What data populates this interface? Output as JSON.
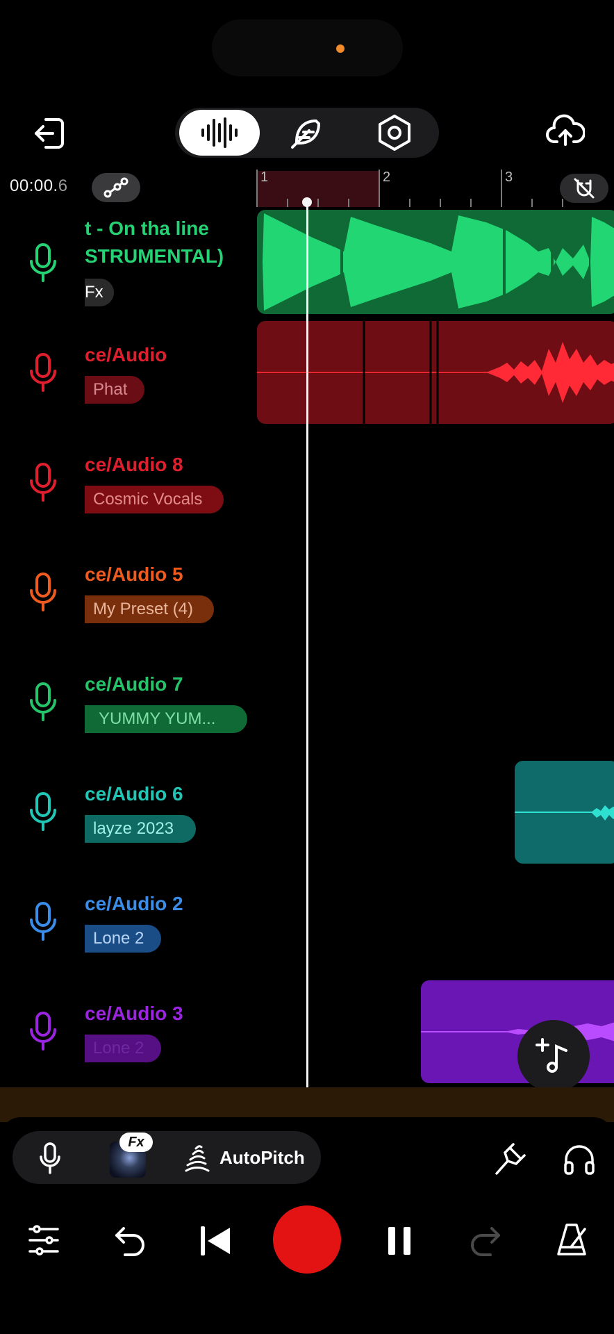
{
  "header": {
    "back_icon": "exit-arrow-icon",
    "modes": [
      {
        "name": "waveform-mode",
        "icon": "waveform-icon",
        "active": true
      },
      {
        "name": "effects-mode",
        "icon": "feather-icon",
        "active": false
      },
      {
        "name": "settings-mode",
        "icon": "hex-nut-icon",
        "active": false
      }
    ],
    "upload_icon": "cloud-upload-icon"
  },
  "timeline": {
    "time_main": "00:00.",
    "time_frac": "6",
    "automation_icon": "automation-nodes-icon",
    "ruler_numbers": [
      "1",
      "2",
      "3"
    ],
    "snap_icon": "magnet-off-icon"
  },
  "tracks": [
    {
      "name_line1": "t - On tha line",
      "name_line2": "STRUMENTAL)",
      "badge": "Fx",
      "color": "#25d274",
      "badge_bg": "#2a2a2a"
    },
    {
      "name_line1": "ce/Audio",
      "badge": "Phat",
      "color": "#e01f2e",
      "badge_bg": "#6a0d14",
      "badge_color": "#d8898f"
    },
    {
      "name_line1": "ce/Audio 8",
      "badge": "Cosmic Vocals",
      "color": "#e01f2e",
      "badge_bg": "#7d0d12",
      "badge_color": "#e38a8a"
    },
    {
      "name_line1": "ce/Audio 5",
      "badge": "My Preset (4)",
      "color": "#ef5a1e",
      "badge_bg": "#7a2f0c",
      "badge_color": "#e9b59a"
    },
    {
      "name_line1": "ce/Audio 7",
      "badge": "YUMMY YUM...",
      "color": "#25c46a",
      "badge_bg": "#0f6a35",
      "badge_color": "#7fe0a5"
    },
    {
      "name_line1": "ce/Audio 6",
      "badge": "layze 2023",
      "color": "#21c6b6",
      "badge_bg": "#0e6a63",
      "badge_color": "#9ff0e6"
    },
    {
      "name_line1": "ce/Audio 2",
      "badge": "Lone 2",
      "color": "#3a8de8",
      "badge_bg": "#1a4c86",
      "badge_color": "#b8d6f6"
    },
    {
      "name_line1": "ce/Audio 3",
      "badge": "Lone 2",
      "color": "#9a24e0",
      "badge_bg": "#561083",
      "badge_color": "#6d2aa0"
    }
  ],
  "controls": {
    "mic_icon": "microphone-icon",
    "fx_label": "Fx",
    "autopitch_label": "AutoPitch",
    "tuning_icon": "tuning-fork-icon",
    "headphones_icon": "headphones-icon",
    "mixer_icon": "sliders-icon",
    "undo_icon": "undo-icon",
    "skip_back_icon": "skip-to-start-icon",
    "record_icon": "record-icon",
    "pause_icon": "pause-icon",
    "redo_icon": "redo-icon",
    "metronome_icon": "metronome-icon",
    "add_track_icon": "add-music-track-icon"
  }
}
